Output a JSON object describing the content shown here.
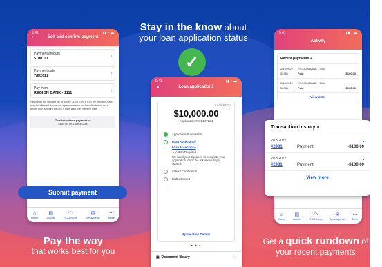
{
  "headline": {
    "bold": "Stay in the know",
    "rest1": " about",
    "line2": "your loan application status"
  },
  "left_caption": {
    "line1": "Pay the way",
    "line2": "that works best for you"
  },
  "right_caption": {
    "pre": "Get a ",
    "bold": "quick rundown",
    "post": " of",
    "line2": "your recent payments"
  },
  "status_time": "9:41",
  "left_phone": {
    "title": "Edit and confirm payment",
    "fields": [
      {
        "label": "Payment amount",
        "value": "$100.00"
      },
      {
        "label": "Payment date",
        "value": "7/6/2022"
      },
      {
        "label": "Pay from",
        "value": "REGION BANK - 1111"
      }
    ],
    "note": "Payments not initiated on or before 11:00 p.m. ET on the effective date may be affected. However, a payment may not be reflected on your online loan account for 2 to 4 days after the effective date.",
    "summary_line1": "This includes a payment of",
    "summary_line2": "$100.00 on Loan #1234",
    "submit_label": "Submit payment",
    "nav": [
      "Home",
      "Activity",
      "FICO Score",
      "Message us",
      "More"
    ]
  },
  "center_phone": {
    "time": "9:41",
    "title": "Loan applications",
    "loan_id": "Loan #2234",
    "amount": "$10,000.00",
    "application": "Application #100147264",
    "steps": [
      "Application Submission",
      "Loan Acceptance",
      "Loan Acceptance",
      "Action Required",
      "We need your signature to complete your application. Click the link above to get started.",
      "School Certification",
      "Disbursement"
    ],
    "details_link": "Application Details",
    "doc_library": "Document library"
  },
  "right_phone": {
    "time": "9:41",
    "title": "Activity",
    "recent_header": "Recent payments",
    "recent": [
      {
        "date": "2/15/2022",
        "bank": "REGION BANK - 3464",
        "ref": "52981",
        "status": "Paid",
        "amount": "-$100.00"
      },
      {
        "date": "2/16/2022",
        "bank": "REGION BANK - 1464",
        "ref": "52981",
        "status": "Paid",
        "amount": "-$100.00"
      }
    ],
    "view_more": "View more",
    "nav": [
      "Home",
      "Activity",
      "FICO Score",
      "Message us",
      "More"
    ]
  },
  "transaction": {
    "header": "Transaction history",
    "rows": [
      {
        "date": "2/15/2022",
        "ref": "#2981",
        "type": "Payment",
        "amount": "-$100.00"
      },
      {
        "date": "2/18/2022",
        "ref": "#2981",
        "type": "Payment",
        "amount": "-$100.00"
      }
    ],
    "view_more": "View more"
  }
}
